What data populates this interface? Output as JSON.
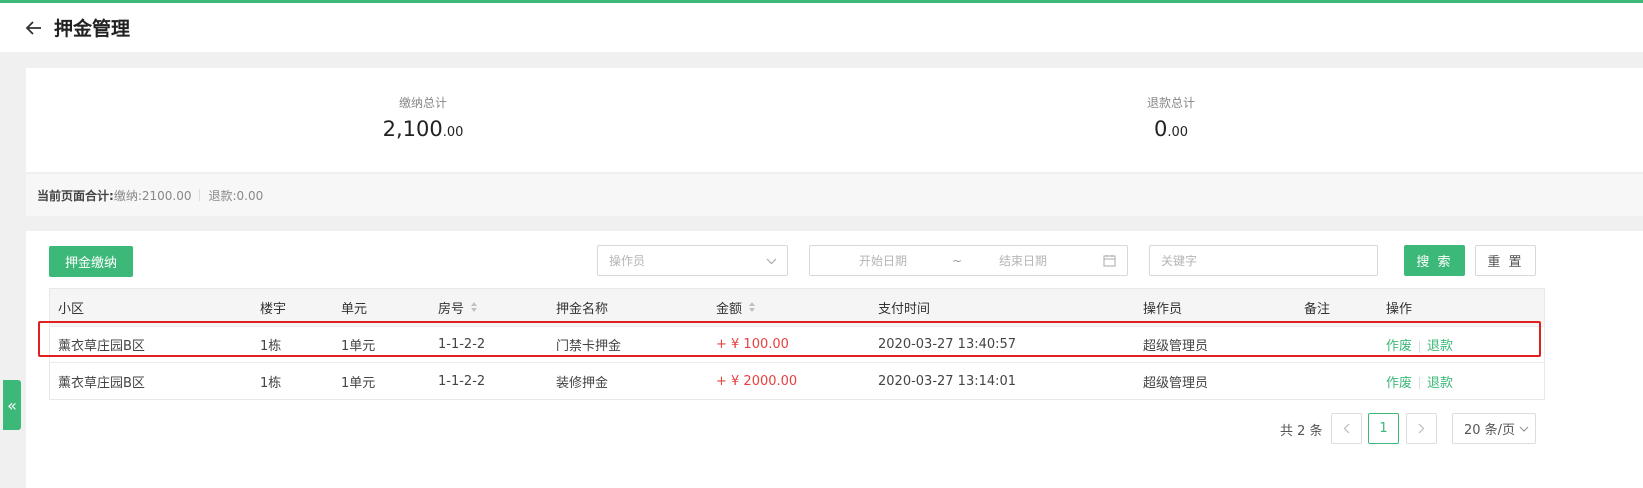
{
  "header": {
    "title": "押金管理"
  },
  "summary": {
    "paid_label": "缴纳总计",
    "paid_int": "2,100",
    "paid_dec": ".00",
    "refund_label": "退款总计",
    "refund_int": "0",
    "refund_dec": ".00"
  },
  "page_sum": {
    "label": "当前页面合计:",
    "paid": "缴纳:2100.00",
    "refund": "退款:0.00"
  },
  "toolbar": {
    "deposit_button": "押金缴纳",
    "operator_placeholder": "操作员",
    "start_date_placeholder": "开始日期",
    "date_separator": "~",
    "end_date_placeholder": "结束日期",
    "keyword_placeholder": "关键字",
    "search_button": "搜 索",
    "reset_button": "重 置"
  },
  "table": {
    "columns": [
      "小区",
      "楼宇",
      "单元",
      "房号",
      "押金名称",
      "金额",
      "支付时间",
      "操作员",
      "备注",
      "操作"
    ],
    "rows": [
      {
        "community": "薰衣草庄园B区",
        "building": "1栋",
        "unit": "1单元",
        "room": "1-1-2-2",
        "name": "门禁卡押金",
        "amount": "+ ¥ 100.00",
        "time": "2020-03-27 13:40:57",
        "operator": "超级管理员",
        "note": "",
        "void": "作废",
        "refund": "退款"
      },
      {
        "community": "薰衣草庄园B区",
        "building": "1栋",
        "unit": "1单元",
        "room": "1-1-2-2",
        "name": "装修押金",
        "amount": "+ ¥ 2000.00",
        "time": "2020-03-27 13:14:01",
        "operator": "超级管理员",
        "note": "",
        "void": "作废",
        "refund": "退款"
      }
    ]
  },
  "pagination": {
    "total": "共 2 条",
    "current_page": "1",
    "page_size": "20 条/页"
  },
  "side_tab": {
    "label": "«"
  },
  "colors": {
    "accent": "#3cb878",
    "money": "#e84040",
    "highlight": "#e02020"
  }
}
